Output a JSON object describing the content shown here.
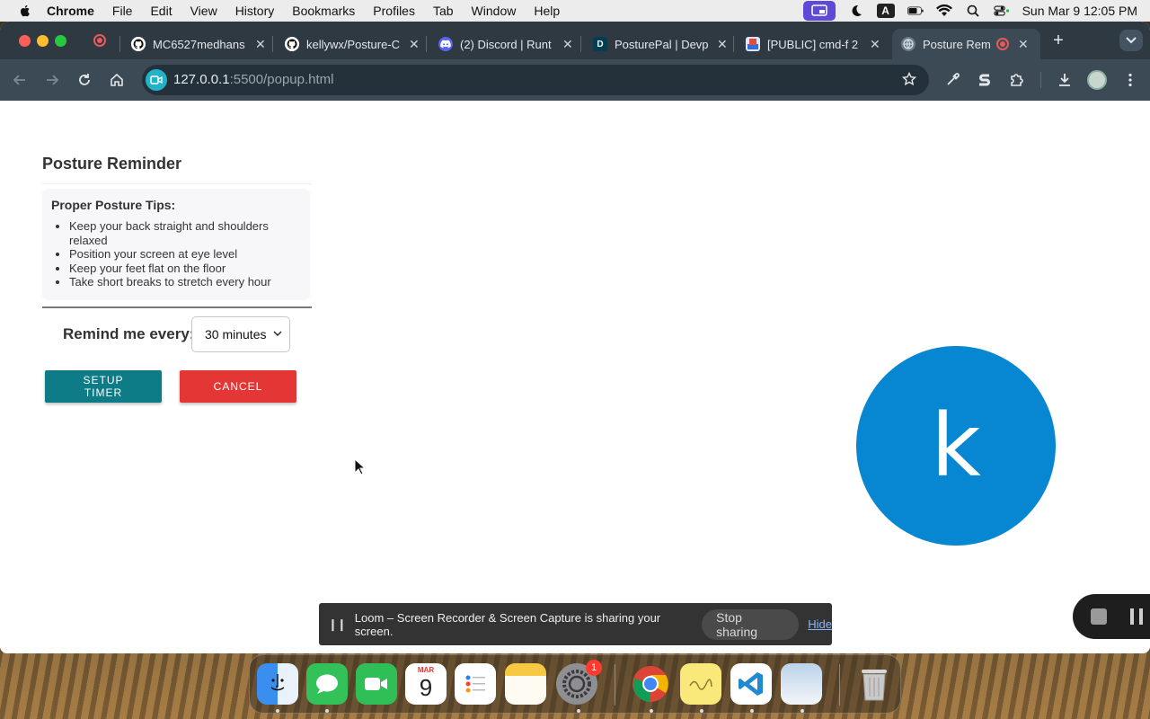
{
  "menubar": {
    "app": "Chrome",
    "items": [
      "File",
      "Edit",
      "View",
      "History",
      "Bookmarks",
      "Profiles",
      "Tab",
      "Window",
      "Help"
    ],
    "clock": "Sun Mar 9  12:05 PM",
    "input_source": "A"
  },
  "browser": {
    "tabs": [
      {
        "title": "MC6527medhans",
        "icon": "github-icon"
      },
      {
        "title": "kellywx/Posture-C",
        "icon": "github-icon"
      },
      {
        "title": "(2) Discord | Runt",
        "icon": "discord-icon"
      },
      {
        "title": "PosturePal | Devp",
        "icon": "devpost-icon",
        "favicon_letter": "D"
      },
      {
        "title": "[PUBLIC] cmd-f 2",
        "icon": "document-icon"
      },
      {
        "title": "Posture Remin",
        "icon": "globe-icon",
        "active": true
      }
    ],
    "url_host": "127.0.0.1",
    "url_path": ":5500/popup.html"
  },
  "popup": {
    "title": "Posture Reminder",
    "tips_title": "Proper Posture Tips:",
    "tips": [
      "Keep your back straight and shoulders relaxed",
      "Position your screen at eye level",
      "Keep your feet flat on the floor",
      "Take short breaks to stretch every hour"
    ],
    "remind_label": "Remind me every:",
    "interval_selected": "30 minutes",
    "setup_button": "SETUP TIMER",
    "cancel_button": "CANCEL"
  },
  "loom": {
    "avatar_letter": "k",
    "share_message": "Loom – Screen Recorder & Screen Capture is sharing your screen.",
    "stop_sharing": "Stop sharing",
    "hide": "Hide"
  },
  "dock": {
    "calendar_month": "MAR",
    "calendar_day": "9",
    "settings_badge": "1"
  },
  "colors": {
    "setup_button": "#0e7c86",
    "cancel_button": "#e53636",
    "loom_avatar": "#0787d1",
    "chrome_frame": "#2e3942"
  }
}
